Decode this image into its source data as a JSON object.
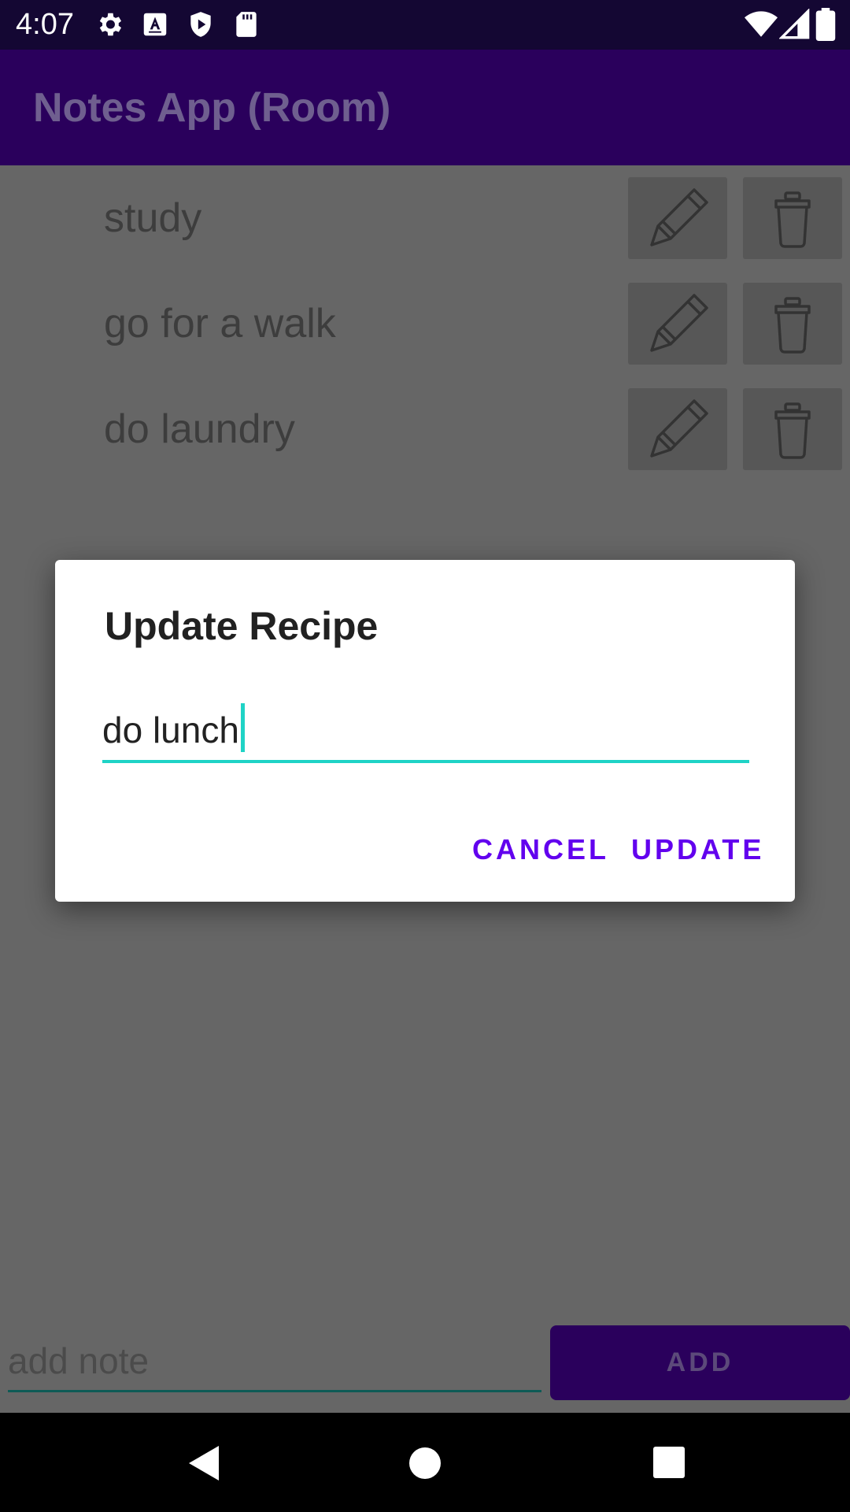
{
  "status_bar": {
    "time": "4:07",
    "left_icons": [
      "settings-icon",
      "keyboard-a-icon",
      "shield-play-icon",
      "sd-card-icon"
    ],
    "right_icons": [
      "wifi-icon",
      "signal-icon",
      "battery-icon"
    ]
  },
  "app_bar": {
    "title": "Notes App (Room)"
  },
  "notes": [
    {
      "text": "study"
    },
    {
      "text": "go for a walk"
    },
    {
      "text": "do laundry"
    }
  ],
  "bottom": {
    "input_placeholder": "add note",
    "add_label": "ADD"
  },
  "dialog": {
    "title": "Update Recipe",
    "input_value": "do lunch",
    "cancel_label": "CANCEL",
    "update_label": "UPDATE"
  },
  "colors": {
    "accent": "#6200ee",
    "input_underline": "#1fd3c6",
    "primary_dark": "#2a005c"
  }
}
